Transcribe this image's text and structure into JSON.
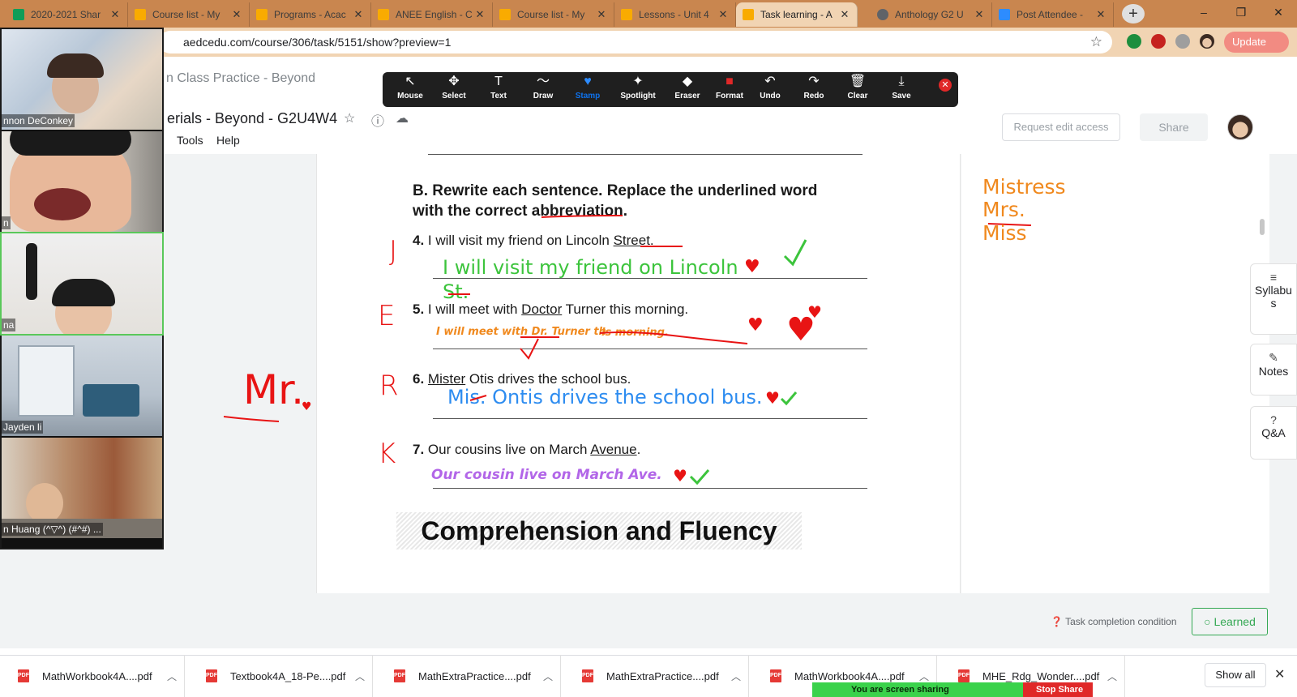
{
  "browser": {
    "tabs": [
      {
        "label": "2020-2021 Shar",
        "color": "#0f9d58"
      },
      {
        "label": "Course list - My",
        "color": "#f9ab00"
      },
      {
        "label": "Programs - Acac",
        "color": "#f9ab00"
      },
      {
        "label": "ANEE English - C",
        "color": "#f9ab00"
      },
      {
        "label": "Course list - My",
        "color": "#f9ab00"
      },
      {
        "label": "Lessons - Unit 4",
        "color": "#f9ab00"
      },
      {
        "label": "Task learning - A",
        "color": "#f9ab00"
      },
      {
        "label": "Anthology G2 U",
        "color": "#5f6368"
      },
      {
        "label": "Post Attendee -",
        "color": "#2d8cff"
      }
    ],
    "active_tab_index": 6,
    "url": "aedcedu.com/course/306/task/5151/show?preview=1",
    "update_label": "Update",
    "new_tab_glyph": "+",
    "win_minimize": "–",
    "win_restore": "❐",
    "win_close": "✕"
  },
  "doc": {
    "class_title": "n Class Practice - Beyond",
    "title": "erials - Beyond - G2U4W4",
    "menu": [
      "Tools",
      "Help"
    ],
    "request_access": "Request edit access",
    "share": "Share"
  },
  "zoom_toolbar": {
    "tools": [
      {
        "label": "Mouse",
        "icon": "cursor-icon",
        "glyph": "↖"
      },
      {
        "label": "Select",
        "icon": "move-icon",
        "glyph": "✥"
      },
      {
        "label": "Text",
        "icon": "text-icon",
        "glyph": "T"
      },
      {
        "label": "Draw",
        "icon": "draw-icon",
        "glyph": "〜"
      },
      {
        "label": "Stamp",
        "icon": "heart-icon",
        "glyph": "♥"
      },
      {
        "label": "Spotlight",
        "icon": "spotlight-icon",
        "glyph": "✦"
      },
      {
        "label": "Eraser",
        "icon": "eraser-icon",
        "glyph": "◆"
      },
      {
        "label": "Format",
        "icon": "format-icon",
        "glyph": "■"
      },
      {
        "label": "Undo",
        "icon": "undo-icon",
        "glyph": "↶"
      },
      {
        "label": "Redo",
        "icon": "redo-icon",
        "glyph": "↷"
      },
      {
        "label": "Clear",
        "icon": "trash-icon",
        "glyph": "🗑"
      },
      {
        "label": "Save",
        "icon": "save-icon",
        "glyph": "⤓"
      }
    ],
    "active_tool": "Stamp",
    "close_glyph": "✕"
  },
  "worksheet": {
    "section_b_line1": "B. Rewrite each sentence. Replace the underlined word",
    "section_b_line2_pre": "with the correct ",
    "section_b_line2_word": "abbreviation",
    "section_b_line2_post": ".",
    "questions": [
      {
        "num": "4.",
        "pre": "I will visit my friend on Lincoln ",
        "underlined": "Street",
        "post": "."
      },
      {
        "num": "5.",
        "pre": "I will meet with ",
        "underlined": "Doctor",
        "post": " Turner this morning."
      },
      {
        "num": "6.",
        "pre": "",
        "underlined": "Mister",
        "post": " Otis drives the school bus."
      },
      {
        "num": "7.",
        "pre": "Our cousins live on March ",
        "underlined": "Avenue",
        "post": "."
      }
    ],
    "answers": [
      "I will visit my friend on Lincoln",
      "St.",
      "I will meet with Dr. Turner th",
      "is morning.",
      "Mis. Ontis drives the school  bus.",
      "Our cousin live on March Ave."
    ],
    "margin_letters": [
      "J",
      "E",
      "R",
      "K"
    ],
    "margin_note": "Mr.",
    "comprehension_title": "Comprehension and Fluency"
  },
  "notes": [
    "Mistress",
    "Mrs.",
    "Miss"
  ],
  "rail": [
    {
      "label": "Syllabu s",
      "icon": "menu-icon",
      "glyph": "≡"
    },
    {
      "label": "Notes",
      "icon": "pencil-icon",
      "glyph": "✎"
    },
    {
      "label": "Q&A",
      "icon": "question-icon",
      "glyph": "?"
    }
  ],
  "task": {
    "condition_label": "Task completion condition",
    "learned_label": "Learned"
  },
  "participants": [
    {
      "name": "nnon DeConkey"
    },
    {
      "name": "n"
    },
    {
      "name": "na"
    },
    {
      "name": "Jayden li"
    },
    {
      "name": "n Huang (^▽^) (#^#) ..."
    }
  ],
  "downloads": {
    "items": [
      "MathWorkbook4A....pdf",
      "Textbook4A_18-Pe....pdf",
      "MathExtraPractice....pdf",
      "MathExtraPractice....pdf",
      "MathWorkbook4A....pdf",
      "MHE_Rdg_Wonder....pdf"
    ],
    "show_all": "Show all"
  },
  "screen_share": {
    "status": "You are screen sharing",
    "stop": "Stop Share"
  },
  "colors": {
    "green_ink": "#3cc43c",
    "orange_ink": "#f0891e",
    "blue_ink": "#2d8cf0",
    "purple_ink": "#b266e8",
    "red_ink": "#e81414"
  }
}
